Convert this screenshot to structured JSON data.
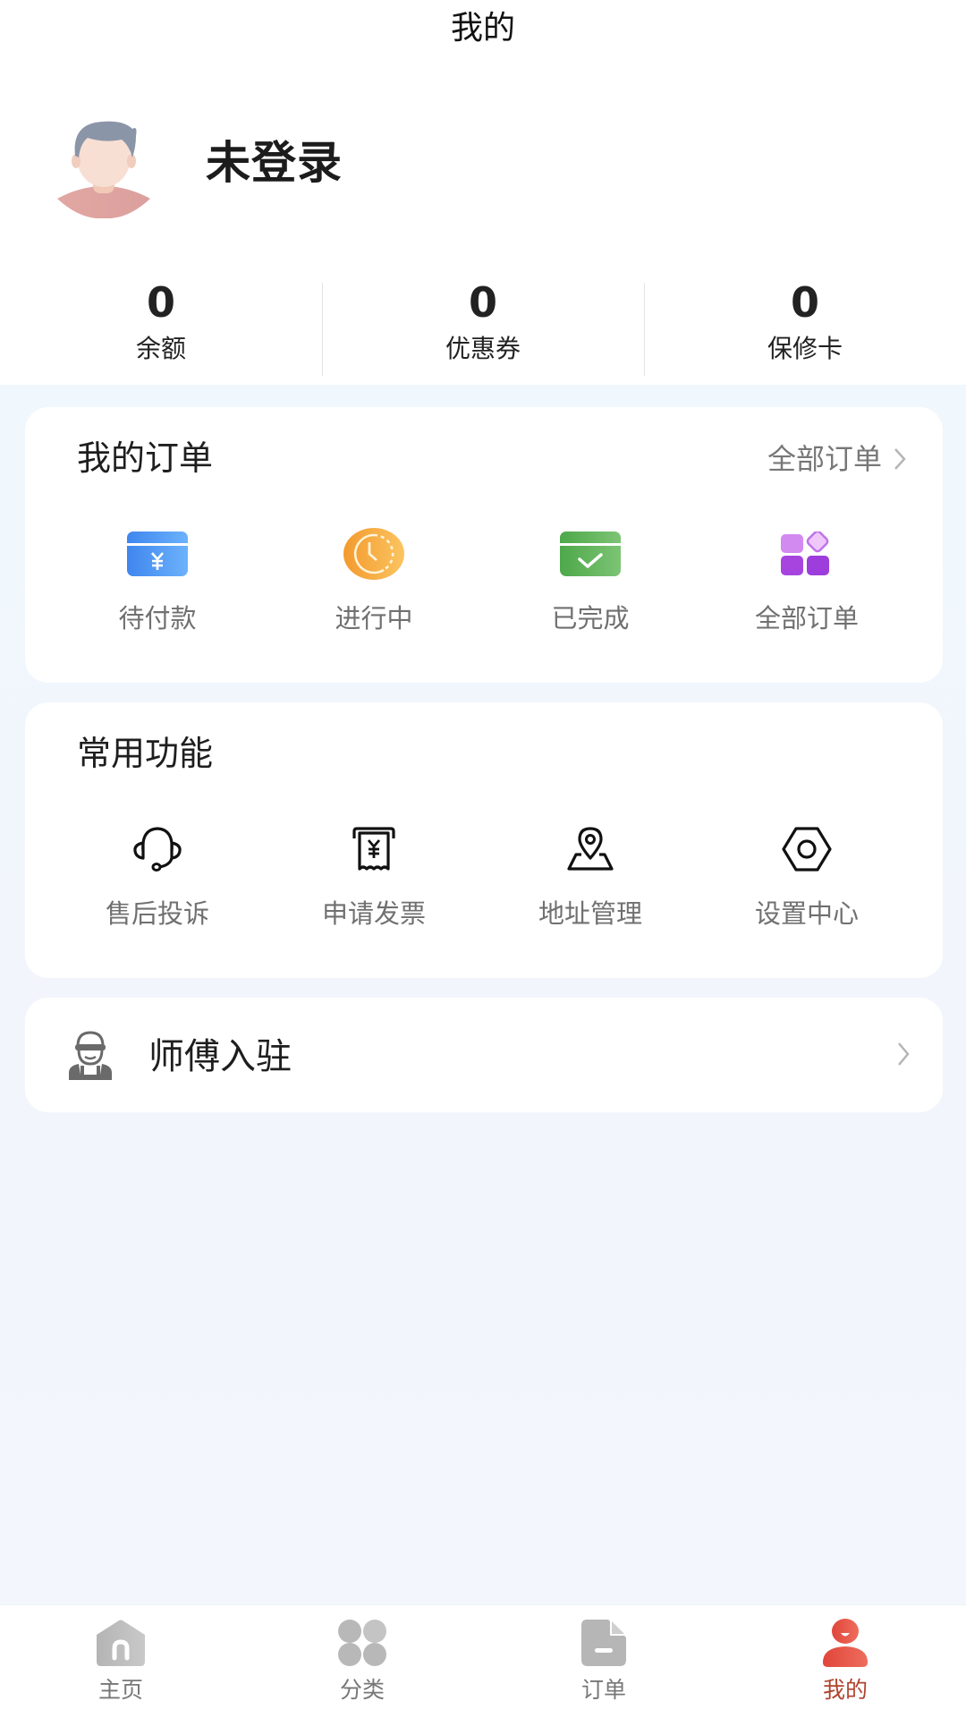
{
  "header": {
    "title": "我的"
  },
  "user": {
    "name": "未登录",
    "avatar_icon": "default-user-avatar"
  },
  "stats": [
    {
      "value": "0",
      "label": "余额"
    },
    {
      "value": "0",
      "label": "优惠券"
    },
    {
      "value": "0",
      "label": "保修卡"
    }
  ],
  "orders": {
    "title": "我的订单",
    "link_label": "全部订单",
    "link_icon": "chevron-right-icon",
    "items": [
      {
        "label": "待付款",
        "icon": "pending-payment-icon",
        "color": "#4a90f0"
      },
      {
        "label": "进行中",
        "icon": "in-progress-clock-icon",
        "color": "#f5a33a"
      },
      {
        "label": "已完成",
        "icon": "completed-check-icon",
        "color": "#5cb85c"
      },
      {
        "label": "全部订单",
        "icon": "all-orders-grid-icon",
        "color": "#a64be8"
      }
    ]
  },
  "features": {
    "title": "常用功能",
    "items": [
      {
        "label": "售后投诉",
        "icon": "headset-icon"
      },
      {
        "label": "申请发票",
        "icon": "invoice-icon"
      },
      {
        "label": "地址管理",
        "icon": "location-pin-icon"
      },
      {
        "label": "设置中心",
        "icon": "settings-hex-icon"
      }
    ]
  },
  "craftsman": {
    "label": "师傅入驻",
    "icon": "worker-icon"
  },
  "tabbar": {
    "active_color": "#e0513a",
    "items": [
      {
        "label": "主页",
        "icon": "home-icon",
        "active": false
      },
      {
        "label": "分类",
        "icon": "category-icon",
        "active": false
      },
      {
        "label": "订单",
        "icon": "order-doc-icon",
        "active": false
      },
      {
        "label": "我的",
        "icon": "profile-icon",
        "active": true
      }
    ]
  }
}
